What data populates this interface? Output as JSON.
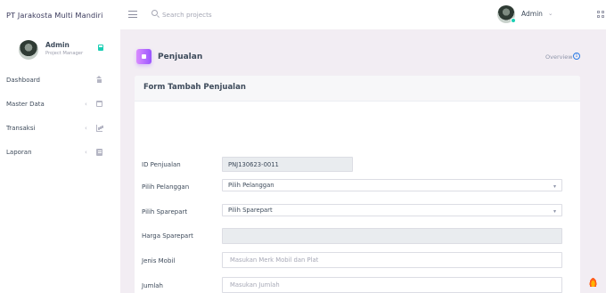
{
  "brand": {
    "name": "PT Jarakosta Multi Mandiri"
  },
  "topbar": {
    "search_placeholder": "Search projects",
    "user_name": "Admin",
    "user_caret": "⌄"
  },
  "sidebar": {
    "profile": {
      "name": "Admin",
      "role": "Project Manager"
    },
    "items": [
      {
        "label": "Dashboard",
        "chevron": "",
        "icon": "home-icon"
      },
      {
        "label": "Master Data",
        "chevron": "‹",
        "icon": "calendar-icon"
      },
      {
        "label": "Transaksi",
        "chevron": "‹",
        "icon": "chart-icon"
      },
      {
        "label": "Laporan",
        "chevron": "‹",
        "icon": "document-icon"
      }
    ]
  },
  "page": {
    "title": "Penjualan",
    "overview_label": "Overview"
  },
  "form": {
    "title": "Form Tambah Penjualan",
    "fields": {
      "id_penjualan": {
        "label": "ID Penjualan",
        "value": "PNJ130623-0011"
      },
      "pelanggan": {
        "label": "Pilih Pelanggan",
        "value": "Pilih Pelanggan"
      },
      "sparepart": {
        "label": "Pilih Sparepart",
        "value": "Pilih Sparepart"
      },
      "harga": {
        "label": "Harga Sparepart",
        "value": ""
      },
      "jenis_mobil": {
        "label": "Jenis Mobil",
        "placeholder": "Masukan Merk Mobil dan Plat"
      },
      "jumlah": {
        "label": "Jumlah",
        "placeholder": "Masukan Jumlah"
      }
    }
  },
  "colors": {
    "accent": "#9a55ff",
    "success": "#1bcfb4",
    "background": "#f2edf3"
  }
}
